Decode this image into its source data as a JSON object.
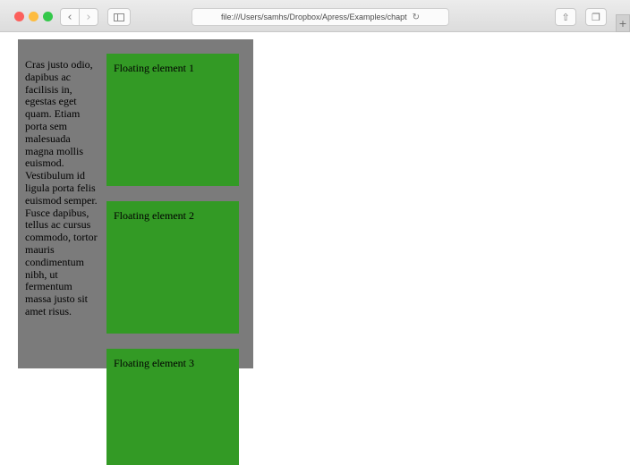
{
  "browser": {
    "address_url": "file:///Users/samhs/Dropbox/Apress/Examples/chapt",
    "reload_icon": "↻",
    "back_icon": "‹",
    "forward_icon": "›",
    "share_icon": "⇧",
    "tabs_icon": "❐",
    "newtab_icon": "+"
  },
  "page": {
    "paragraph": "Cras justo odio, dapibus ac facilisis in, egestas eget quam. Etiam porta sem malesuada magna mollis euismod. Vestibulum id ligula porta felis euismod semper. Fusce dapibus, tellus ac cursus commodo, tortor mauris condimentum nibh, ut fermentum massa justo sit amet risus.",
    "floats": [
      {
        "label": "Floating element 1"
      },
      {
        "label": "Floating element 2"
      },
      {
        "label": "Floating element 3"
      }
    ],
    "colors": {
      "container_bg": "#7b7b7b",
      "float_bg": "#339a25"
    }
  }
}
